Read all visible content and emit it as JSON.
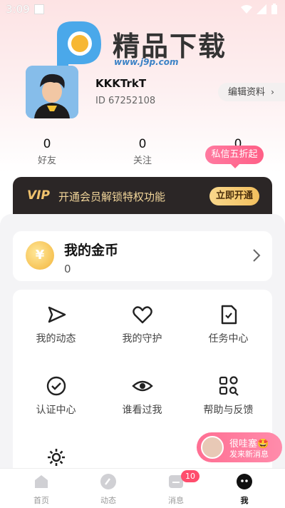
{
  "status_bar": {
    "time": "3:09"
  },
  "watermark": {
    "title": "精品下载",
    "url": "www.j9p.com"
  },
  "profile": {
    "username": "KKKTrkT",
    "id": "ID 67252108",
    "edit_label": "编辑资料"
  },
  "stats": [
    {
      "value": "0",
      "label": "好友"
    },
    {
      "value": "0",
      "label": "关注"
    },
    {
      "value": "0"
    }
  ],
  "dm_promo": "私信五折起",
  "vip": {
    "logo": "VIP",
    "text": "开通会员解锁特权功能",
    "button": "立即开通"
  },
  "coins": {
    "title": "我的金币",
    "value": "0"
  },
  "grid": [
    {
      "label": "我的动态",
      "icon": "send-icon"
    },
    {
      "label": "我的守护",
      "icon": "heart-icon"
    },
    {
      "label": "任务中心",
      "icon": "document-icon"
    },
    {
      "label": "认证中心",
      "icon": "check-circle-icon"
    },
    {
      "label": "谁看过我",
      "icon": "eye-icon"
    },
    {
      "label": "帮助与反馈",
      "icon": "apps-search-icon"
    },
    {
      "label": "",
      "icon": "settings-icon"
    }
  ],
  "notification": {
    "name": "很哇塞🤩",
    "text": "发来新消息"
  },
  "nav": [
    {
      "label": "首页",
      "icon": "home-icon"
    },
    {
      "label": "动态",
      "icon": "compass-icon"
    },
    {
      "label": "消息",
      "icon": "message-icon",
      "badge": "10"
    },
    {
      "label": "我",
      "icon": "me-icon"
    }
  ],
  "colors": {
    "accent": "#ff5f86",
    "vip_gold": "#f2bf5e",
    "vip_bg": "#2b2626"
  }
}
